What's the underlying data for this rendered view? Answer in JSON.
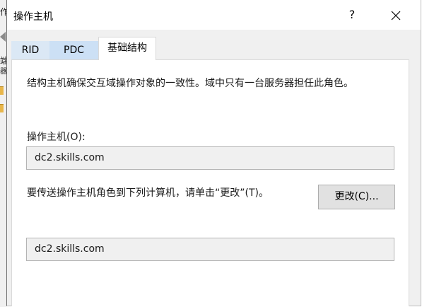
{
  "background_window": {
    "text_fragments": [
      "作",
      "端",
      "器",
      "·"
    ]
  },
  "dialog": {
    "title": "操作主机",
    "help_label": "?",
    "close_icon": "close-icon"
  },
  "tabs": [
    {
      "label": "RID",
      "selected": false
    },
    {
      "label": "PDC",
      "selected": false
    },
    {
      "label": "基础结构",
      "selected": true
    }
  ],
  "panel": {
    "description": "结构主机确保交互域操作对象的一致性。域中只有一台服务器担任此角色。",
    "owner_label": "操作主机(O):",
    "owner_value": "dc2.skills.com",
    "transfer_text": "要传送操作主机角色到下列计算机，请单击“更改”(T)。",
    "change_button": "更改(C)...",
    "target_value": "dc2.skills.com"
  },
  "colors": {
    "dialog_bg": "#f0f0f0",
    "tab_rid_bg": "#dbe8f5",
    "tab_pdc_bg": "#cce0f5",
    "button_bg": "#e1e1e1",
    "field_bg": "#f0f0f0"
  }
}
